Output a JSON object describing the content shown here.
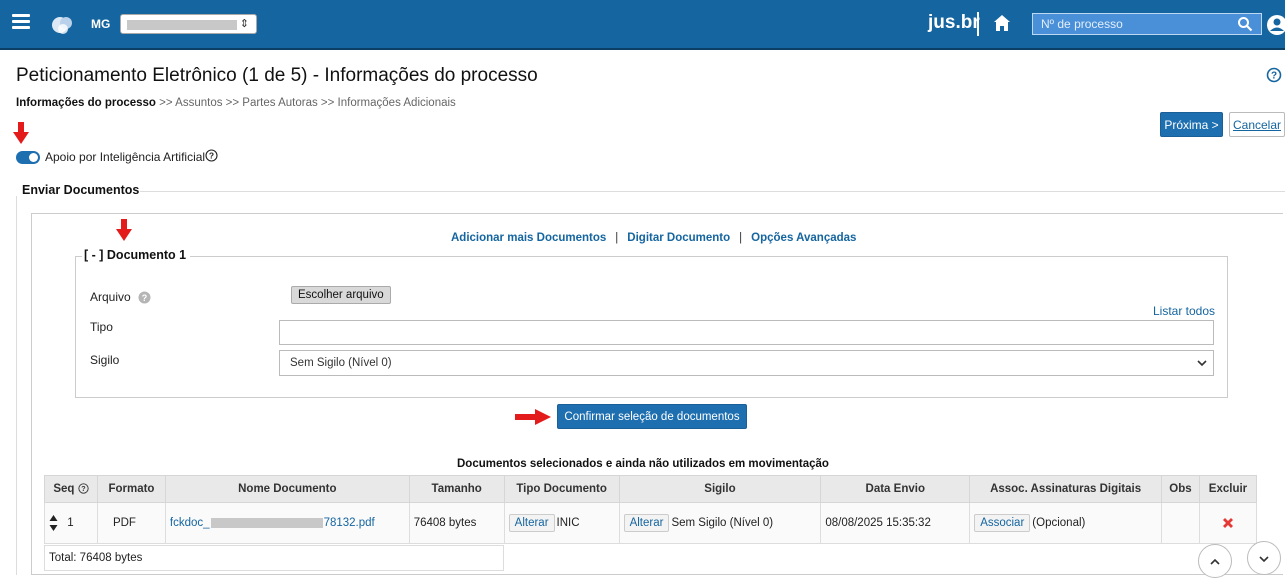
{
  "header": {
    "state": "MG",
    "brand": "jus.br",
    "search_placeholder": "Nº de processo"
  },
  "page": {
    "title": "Peticionamento Eletrônico (1 de 5) - Informações do processo",
    "breadcrumb": {
      "current": "Informações do processo",
      "rest": ">> Assuntos >> Partes Autoras >> Informações Adicionais"
    },
    "next_label": "Próxima >",
    "cancel_label": "Cancelar",
    "ai_label": "Apoio por Inteligência Artificial",
    "ai_enabled": true
  },
  "section": {
    "title": "Enviar Documentos",
    "links": {
      "add": "Adicionar mais Documentos",
      "type": "Digitar Documento",
      "advanced": "Opções Avançadas",
      "separator": "|"
    }
  },
  "document": {
    "legend": "[ - ] Documento 1",
    "file_label": "Arquivo",
    "file_button": "Escolher arquivo",
    "list_all": "Listar todos",
    "type_label": "Tipo",
    "type_value": "",
    "secrecy_label": "Sigilo",
    "secrecy_value": "Sem Sigilo (Nível 0)",
    "confirm_label": "Confirmar seleção de documentos"
  },
  "table": {
    "caption": "Documentos selecionados e ainda não utilizados em movimentação",
    "headers": [
      "Seq",
      "Formato",
      "Nome Documento",
      "Tamanho",
      "Tipo Documento",
      "Sigilo",
      "Data Envio",
      "Assoc. Assinaturas Digitais",
      "Obs",
      "Excluir"
    ],
    "row": {
      "seq": "1",
      "format": "PDF",
      "name_prefix": "fckdoc_",
      "name_suffix": "78132.pdf",
      "size": "76408 bytes",
      "alter_label": "Alterar",
      "doc_type": "INIC",
      "secrecy": "Sem Sigilo (Nível 0)",
      "date": "08/08/2025 15:35:32",
      "associate_label": "Associar",
      "associate_note": "(Opcional)",
      "obs": ""
    },
    "total": "Total: 76408 bytes"
  },
  "colors": {
    "header_bg": "#1565a0",
    "primary_button": "#1e6fb0",
    "link": "#1565a0",
    "annotation_arrow": "#e31b1b",
    "delete_icon": "#e53935"
  }
}
